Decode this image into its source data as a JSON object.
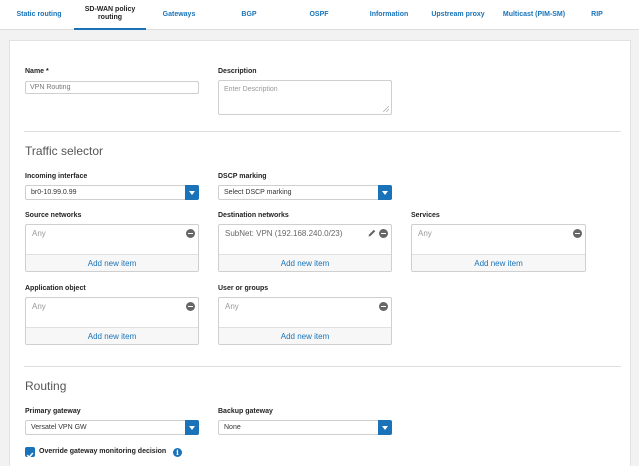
{
  "tabs": [
    {
      "label": "Static routing"
    },
    {
      "label": "SD-WAN policy routing"
    },
    {
      "label": "Gateways"
    },
    {
      "label": "BGP"
    },
    {
      "label": "OSPF"
    },
    {
      "label": "Information"
    },
    {
      "label": "Upstream proxy"
    },
    {
      "label": "Multicast (PIM-SM)"
    },
    {
      "label": "RIP"
    }
  ],
  "active_tab": "SD-WAN policy routing",
  "name": {
    "label": "Name *",
    "placeholder": "VPN Routing"
  },
  "description": {
    "label": "Description",
    "placeholder": "Enter Description"
  },
  "traffic_selector": {
    "title": "Traffic selector",
    "incoming_interface": {
      "label": "Incoming interface",
      "value": "br0-10.99.0.99"
    },
    "dscp_marking": {
      "label": "DSCP marking",
      "value": "Select DSCP marking"
    },
    "source_networks": {
      "label": "Source networks",
      "item": "Any",
      "add": "Add new item"
    },
    "destination_networks": {
      "label": "Destination networks",
      "item": "SubNet: VPN (192.168.240.0/23)",
      "add": "Add new item"
    },
    "services": {
      "label": "Services",
      "item": "Any",
      "add": "Add new item"
    },
    "application_object": {
      "label": "Application object",
      "item": "Any",
      "add": "Add new item"
    },
    "user_or_groups": {
      "label": "User or groups",
      "item": "Any",
      "add": "Add new item"
    }
  },
  "routing": {
    "title": "Routing",
    "primary_gateway": {
      "label": "Primary gateway",
      "value": "Versatel VPN GW"
    },
    "backup_gateway": {
      "label": "Backup gateway",
      "value": "None"
    },
    "override": {
      "label": "Override gateway monitoring decision",
      "checked": true
    }
  },
  "colors": {
    "accent": "#1a73b8",
    "panel": "#ffffff",
    "background": "#f2f2f2"
  }
}
